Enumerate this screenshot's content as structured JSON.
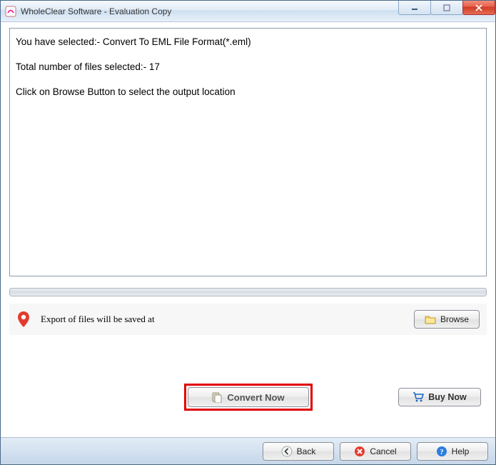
{
  "window": {
    "title": "WholeClear Software - Evaluation Copy"
  },
  "info": {
    "line1": "You have selected:- Convert To EML File Format(*.eml)",
    "line2": "Total number of files selected:- 17",
    "line3": "Click on Browse Button to select the output location"
  },
  "export": {
    "label": "Export of files will be saved at",
    "browse": "Browse"
  },
  "actions": {
    "convert": "Convert Now",
    "buy": "Buy Now"
  },
  "footer": {
    "back": "Back",
    "cancel": "Cancel",
    "help": "Help"
  }
}
